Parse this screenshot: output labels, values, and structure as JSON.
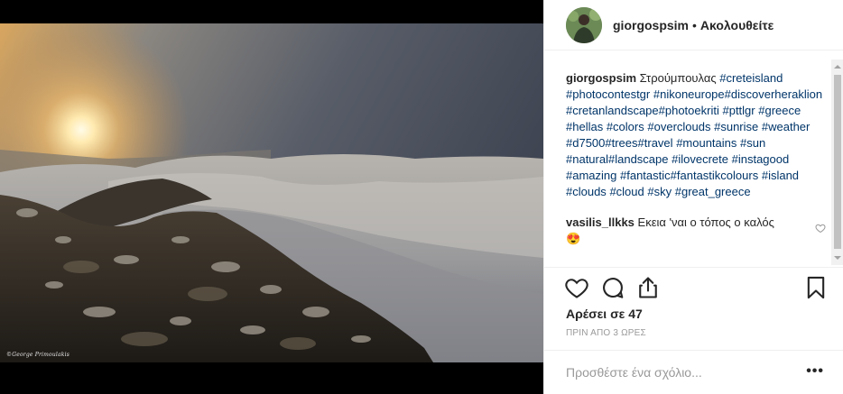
{
  "post": {
    "watermark": "©George Primoulakis"
  },
  "header": {
    "username": "giorgospsim",
    "separator": "•",
    "follow_status": "Ακολουθείτε"
  },
  "caption": {
    "username": "giorgospsim",
    "text": "Στρούμπουλας",
    "hashtags": [
      "#creteisland",
      "#photocontestgr",
      "#nikoneurope",
      "#discoverheraklion",
      "#cretanlandscape",
      "#photoekriti",
      "#pttlgr",
      "#greece",
      "#hellas",
      "#colors",
      "#overclouds",
      "#sunrise",
      "#weather",
      "#d7500",
      "#trees",
      "#travel",
      "#mountains",
      "#sun",
      "#natural",
      "#landscape",
      "#ilovecrete",
      "#instagood",
      "#amazing",
      "#fantastic",
      "#fantastikcolours",
      "#island",
      "#clouds",
      "#cloud",
      "#sky",
      "#great_greece"
    ]
  },
  "comment": {
    "username": "vasilis_llkks",
    "text": "Εκεια 'ναι ο τόπος ο καλός 😍"
  },
  "actions": {
    "like_icon": "heart-icon",
    "comment_icon": "comment-icon",
    "share_icon": "share-icon",
    "save_icon": "bookmark-icon"
  },
  "likes_text": "Αρέσει σε 47",
  "time_text": "ΠΡΙΝ ΑΠΟ 3 ΩΡΕΣ",
  "add_comment": {
    "placeholder": "Προσθέστε ένα σχόλιο...",
    "more_label": "•••"
  },
  "colors": {
    "hashtag": "#003569",
    "text": "#262626",
    "muted": "#999999",
    "divider": "#efefef"
  }
}
